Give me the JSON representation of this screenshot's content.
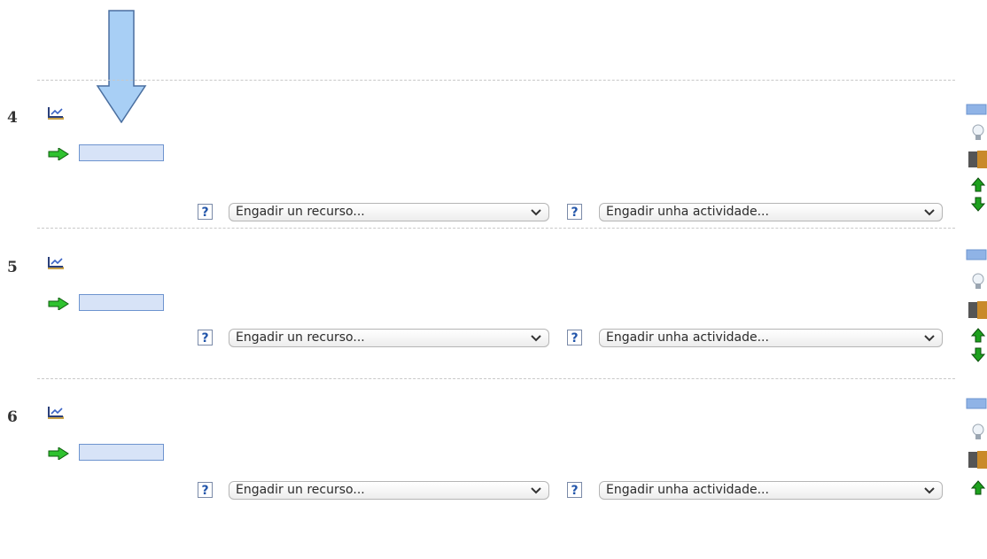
{
  "annotation": {
    "arrow_icon": "large-down-arrow-annotation",
    "arrow_color": "#9ec7f5"
  },
  "sections": [
    {
      "number": "4",
      "resource_select": "Engadir un recurso...",
      "activity_select": "Engadir unha actividade...",
      "controls": [
        "highlight-icon",
        "visibility-bulb-icon",
        "group-mode-icon",
        "move-up-icon",
        "move-down-icon"
      ]
    },
    {
      "number": "5",
      "resource_select": "Engadir un recurso...",
      "activity_select": "Engadir unha actividade...",
      "controls": [
        "highlight-icon",
        "visibility-bulb-icon",
        "group-mode-icon",
        "move-up-icon",
        "move-down-icon"
      ]
    },
    {
      "number": "6",
      "resource_select": "Engadir un recurso...",
      "activity_select": "Engadir unha actividade...",
      "controls": [
        "highlight-icon",
        "visibility-bulb-icon",
        "group-mode-icon",
        "move-up-icon"
      ]
    }
  ],
  "colors": {
    "move_arrow": "#1fae1f",
    "drop_target_fill": "#d7e3f7",
    "drop_target_border": "#6e94cf",
    "help_icon": "#2255aa",
    "up_down_arrows": "#0e7f0e"
  }
}
